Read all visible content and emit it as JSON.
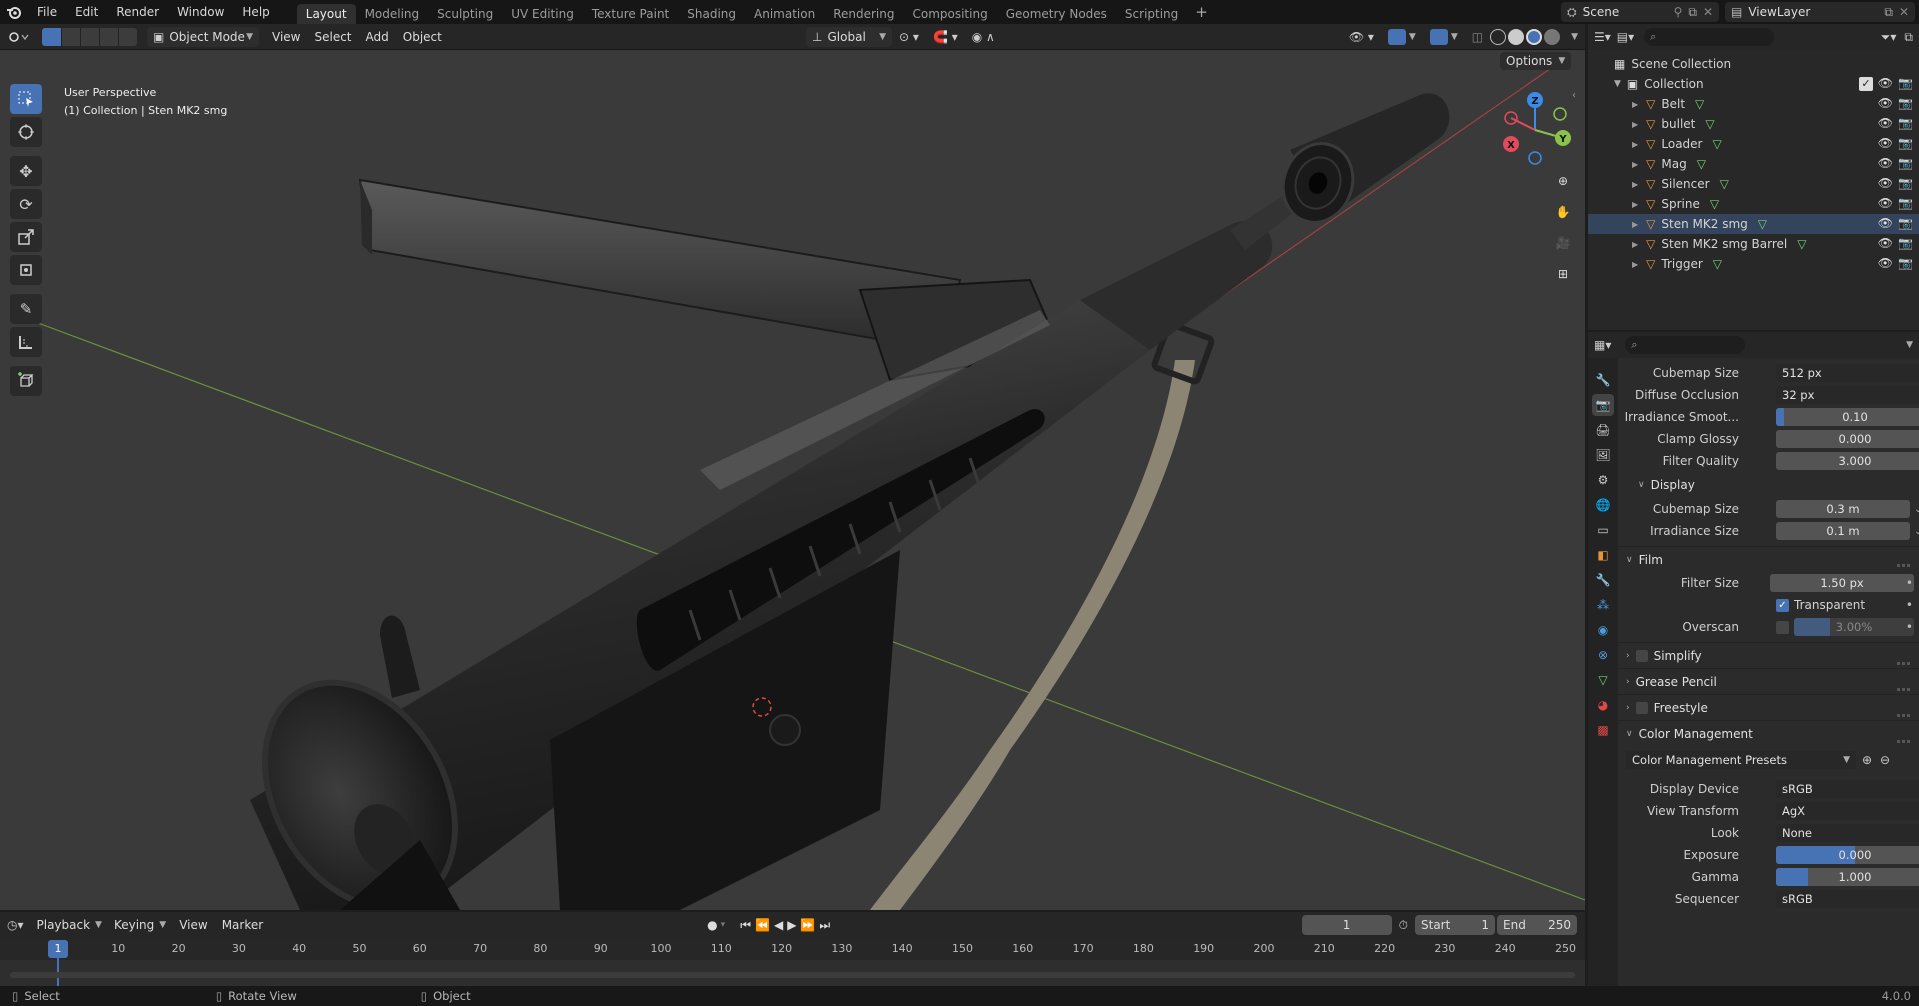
{
  "menu": {
    "file": "File",
    "edit": "Edit",
    "render": "Render",
    "window": "Window",
    "help": "Help"
  },
  "workspaces": [
    "Layout",
    "Modeling",
    "Sculpting",
    "UV Editing",
    "Texture Paint",
    "Shading",
    "Animation",
    "Rendering",
    "Compositing",
    "Geometry Nodes",
    "Scripting"
  ],
  "active_workspace": "Layout",
  "scene": {
    "name": "Scene",
    "view_layer": "ViewLayer"
  },
  "viewport_header": {
    "mode": "Object Mode",
    "view": "View",
    "select": "Select",
    "add": "Add",
    "object": "Object",
    "orientation": "Global",
    "options": "Options"
  },
  "viewport_overlay": {
    "line1": "User Perspective",
    "line2": "(1) Collection | Sten MK2 smg"
  },
  "gizmo": {
    "x": "X",
    "y": "Y",
    "z": "Z"
  },
  "outliner": {
    "root": "Scene Collection",
    "collection": "Collection",
    "items": [
      {
        "name": "Belt"
      },
      {
        "name": "bullet"
      },
      {
        "name": "Loader"
      },
      {
        "name": "Mag"
      },
      {
        "name": "Silencer"
      },
      {
        "name": "Sprine"
      },
      {
        "name": "Sten MK2 smg",
        "active": true
      },
      {
        "name": "Sten MK2 smg Barrel"
      },
      {
        "name": "Trigger"
      }
    ]
  },
  "properties": {
    "indirect": [
      {
        "label": "Cubemap Size",
        "value": "512 px",
        "kind": "select"
      },
      {
        "label": "Diffuse Occlusion",
        "value": "32 px",
        "kind": "select"
      },
      {
        "label": "Irradiance Smoot...",
        "value": "0.10",
        "kind": "slider",
        "fill": 0.05
      },
      {
        "label": "Clamp Glossy",
        "value": "0.000",
        "kind": "num"
      },
      {
        "label": "Filter Quality",
        "value": "3.000",
        "kind": "num"
      }
    ],
    "display": {
      "title": "Display",
      "rows": [
        {
          "label": "Cubemap Size",
          "value": "0.3 m"
        },
        {
          "label": "Irradiance Size",
          "value": "0.1 m"
        }
      ]
    },
    "film": {
      "title": "Film",
      "filter_size_label": "Filter Size",
      "filter_size": "1.50 px",
      "transparent_label": "Transparent",
      "transparent": true,
      "overscan_label": "Overscan",
      "overscan": "3.00%"
    },
    "simplify": "Simplify",
    "grease_pencil": "Grease Pencil",
    "freestyle": "Freestyle",
    "color_management": {
      "title": "Color Management",
      "presets": "Color Management Presets",
      "rows": [
        {
          "label": "Display Device",
          "value": "sRGB",
          "kind": "select"
        },
        {
          "label": "View Transform",
          "value": "AgX",
          "kind": "select"
        },
        {
          "label": "Look",
          "value": "None",
          "kind": "select"
        },
        {
          "label": "Exposure",
          "value": "0.000",
          "kind": "slider",
          "fill": 0.5
        },
        {
          "label": "Gamma",
          "value": "1.000",
          "kind": "slider",
          "fill": 0.2
        },
        {
          "label": "Sequencer",
          "value": "sRGB",
          "kind": "select"
        }
      ]
    }
  },
  "timeline": {
    "playback": "Playback",
    "keying": "Keying",
    "view": "View",
    "marker": "Marker",
    "current_frame": "1",
    "start_label": "Start",
    "start": "1",
    "end_label": "End",
    "end": "250",
    "ticks": [
      "10",
      "20",
      "30",
      "40",
      "50",
      "60",
      "70",
      "80",
      "90",
      "100",
      "110",
      "120",
      "130",
      "140",
      "150",
      "160",
      "170",
      "180",
      "190",
      "200",
      "210",
      "220",
      "230",
      "240",
      "250"
    ]
  },
  "status": {
    "select": "Select",
    "rotate": "Rotate View",
    "object": "Object",
    "version": "4.0.0"
  },
  "colors": {
    "accent": "#4772b3",
    "x_axis": "#e44b5a",
    "y_axis": "#8bc34a",
    "z_axis": "#3b8bea",
    "object_orange": "#e6953a",
    "mesh_green": "#6fd36f"
  }
}
